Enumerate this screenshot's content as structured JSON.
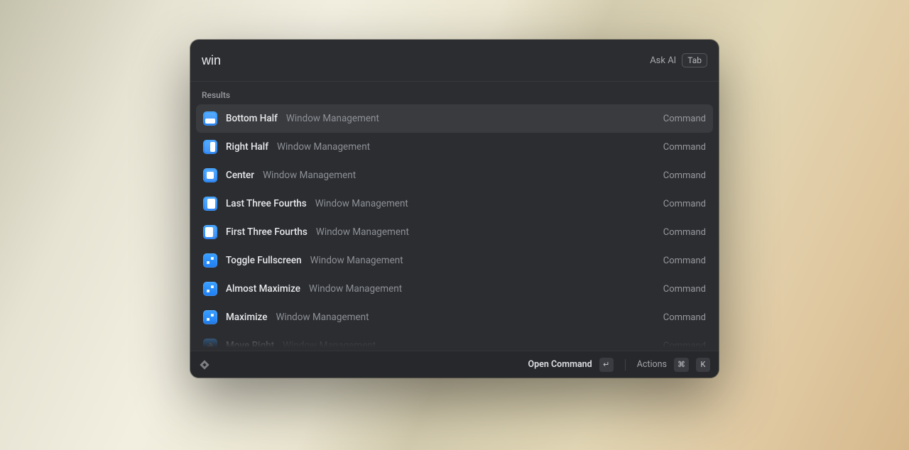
{
  "search": {
    "value": "win",
    "ask_ai": "Ask AI",
    "tab_key": "Tab"
  },
  "section_label": "Results",
  "results": [
    {
      "title": "Bottom Half",
      "subtitle": "Window Management",
      "badge": "Command",
      "icon": "bottom-half",
      "selected": true
    },
    {
      "title": "Right Half",
      "subtitle": "Window Management",
      "badge": "Command",
      "icon": "right-half",
      "selected": false
    },
    {
      "title": "Center",
      "subtitle": "Window Management",
      "badge": "Command",
      "icon": "center",
      "selected": false
    },
    {
      "title": "Last Three Fourths",
      "subtitle": "Window Management",
      "badge": "Command",
      "icon": "right-3-4",
      "selected": false
    },
    {
      "title": "First Three Fourths",
      "subtitle": "Window Management",
      "badge": "Command",
      "icon": "left-3-4",
      "selected": false
    },
    {
      "title": "Toggle Fullscreen",
      "subtitle": "Window Management",
      "badge": "Command",
      "icon": "fullscreen",
      "selected": false
    },
    {
      "title": "Almost Maximize",
      "subtitle": "Window Management",
      "badge": "Command",
      "icon": "expand",
      "selected": false
    },
    {
      "title": "Maximize",
      "subtitle": "Window Management",
      "badge": "Command",
      "icon": "expand",
      "selected": false
    },
    {
      "title": "Move Right",
      "subtitle": "Window Management",
      "badge": "Command",
      "icon": "move-right",
      "selected": false
    }
  ],
  "footer": {
    "open_command": "Open Command",
    "enter_glyph": "↵",
    "actions": "Actions",
    "cmd_glyph": "⌘",
    "k_key": "K"
  }
}
